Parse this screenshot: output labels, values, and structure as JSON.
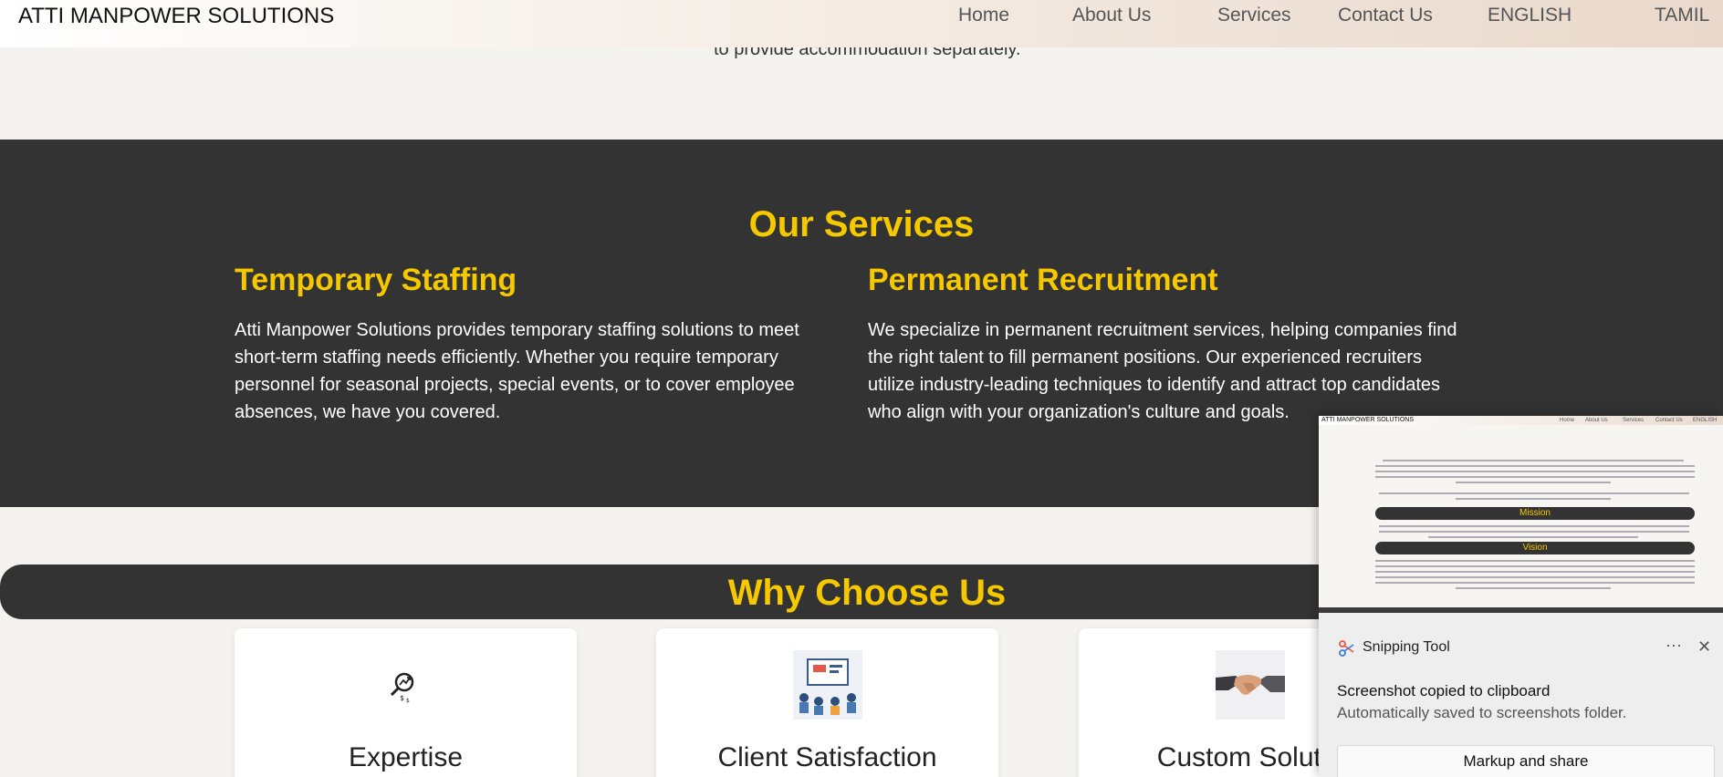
{
  "nav": {
    "brand": "ATTI MANPOWER SOLUTIONS",
    "links": [
      "Home",
      "About Us",
      "Services",
      "Contact Us",
      "ENGLISH",
      "TAMIL"
    ]
  },
  "partial_text": "to provide accommodation separately.",
  "services": {
    "title": "Our Services",
    "items": [
      {
        "heading": "Temporary Staffing",
        "text": "Atti Manpower Solutions provides temporary staffing solutions to meet short-term staffing needs efficiently. Whether you require temporary personnel for seasonal projects, special events, or to cover employee absences, we have you covered."
      },
      {
        "heading": "Permanent Recruitment",
        "text": "We specialize in permanent recruitment services, helping companies find the right talent to fill permanent positions. Our experienced recruiters utilize industry-leading techniques to identify and attract top candidates who align with your organization's culture and goals."
      }
    ]
  },
  "why": {
    "title": "Why Choose Us",
    "cards": [
      {
        "label": "Expertise",
        "icon": "magnifier-growth-icon"
      },
      {
        "label": "Client Satisfaction",
        "icon": "presentation-meeting-icon"
      },
      {
        "label": "Custom Solutio",
        "icon": "handshake-icon"
      }
    ]
  },
  "snipping_tool": {
    "app_name": "Snipping Tool",
    "more": "···",
    "close": "✕",
    "message": "Screenshot copied to clipboard",
    "submessage": "Automatically saved to screenshots folder.",
    "button": "Markup and share",
    "preview": {
      "brand": "ATTI MANPOWER SOLUTIONS",
      "links": [
        "Home",
        "About Us",
        "Services",
        "Contact Us",
        "ENGLISH"
      ],
      "mission": "Mission",
      "vision": "Vision"
    }
  },
  "colors": {
    "accent": "#f5c800",
    "dark": "#333333",
    "page_bg": "#f5f3ef"
  }
}
